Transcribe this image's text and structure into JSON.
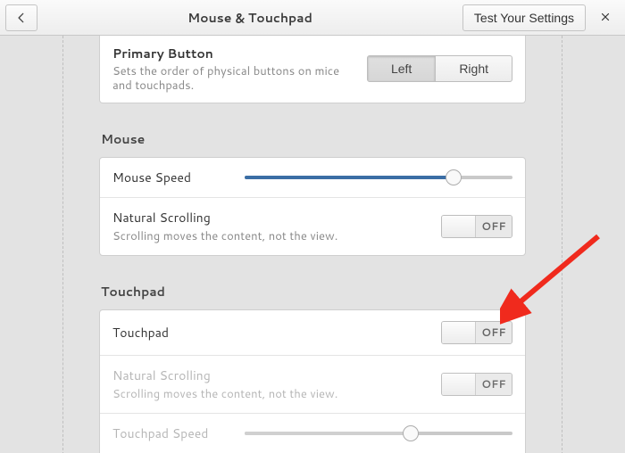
{
  "header": {
    "title": "Mouse & Touchpad",
    "test_button": "Test Your Settings"
  },
  "primary": {
    "title": "Primary Button",
    "desc": "Sets the order of physical buttons on mice and touchpads.",
    "options": {
      "left": "Left",
      "right": "Right"
    },
    "active": "left"
  },
  "sections": {
    "mouse": {
      "label": "Mouse",
      "speed_label": "Mouse Speed",
      "speed_pct": 78,
      "natural_scroll": {
        "title": "Natural Scrolling",
        "desc": "Scrolling moves the content, not the view.",
        "state": "OFF"
      }
    },
    "touchpad": {
      "label": "Touchpad",
      "enable": {
        "title": "Touchpad",
        "state": "OFF"
      },
      "natural_scroll": {
        "title": "Natural Scrolling",
        "desc": "Scrolling moves the content, not the view.",
        "state": "OFF"
      },
      "speed_label": "Touchpad Speed",
      "speed_pct": 62
    }
  },
  "annotation": {
    "type": "arrow",
    "points_to": "touchpad-toggle"
  }
}
